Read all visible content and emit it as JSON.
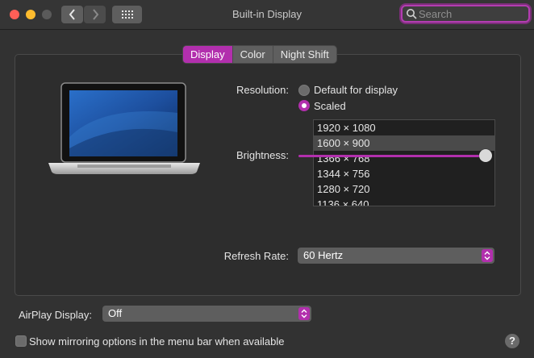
{
  "window": {
    "title": "Built-in Display",
    "traffic_colors": {
      "close": "#ff5f57",
      "minimize": "#febc2e",
      "zoom": "#5a5a5a"
    }
  },
  "toolbar": {
    "back_icon": "chevron-left-icon",
    "forward_icon": "chevron-right-icon",
    "grid_icon": "grid-icon"
  },
  "search": {
    "placeholder": "Search",
    "value": ""
  },
  "tabs": [
    {
      "label": "Display",
      "active": true
    },
    {
      "label": "Color",
      "active": false
    },
    {
      "label": "Night Shift",
      "active": false
    }
  ],
  "resolution": {
    "label": "Resolution:",
    "options": [
      {
        "label": "Default for display",
        "selected": false
      },
      {
        "label": "Scaled",
        "selected": true
      }
    ],
    "list": [
      "1920 × 1080",
      "1600 × 900",
      "1366 × 768",
      "1344 × 756",
      "1280 × 720",
      "1136 × 640"
    ],
    "selected_index": 1
  },
  "brightness": {
    "label": "Brightness:",
    "level": 0.96
  },
  "refresh_rate": {
    "label": "Refresh Rate:",
    "value": "60 Hertz"
  },
  "airplay": {
    "label": "AirPlay Display:",
    "value": "Off"
  },
  "mirroring": {
    "label": "Show mirroring options in the menu bar when available",
    "checked": false
  },
  "help": {
    "label": "?"
  },
  "accent_color": "#b22fad"
}
